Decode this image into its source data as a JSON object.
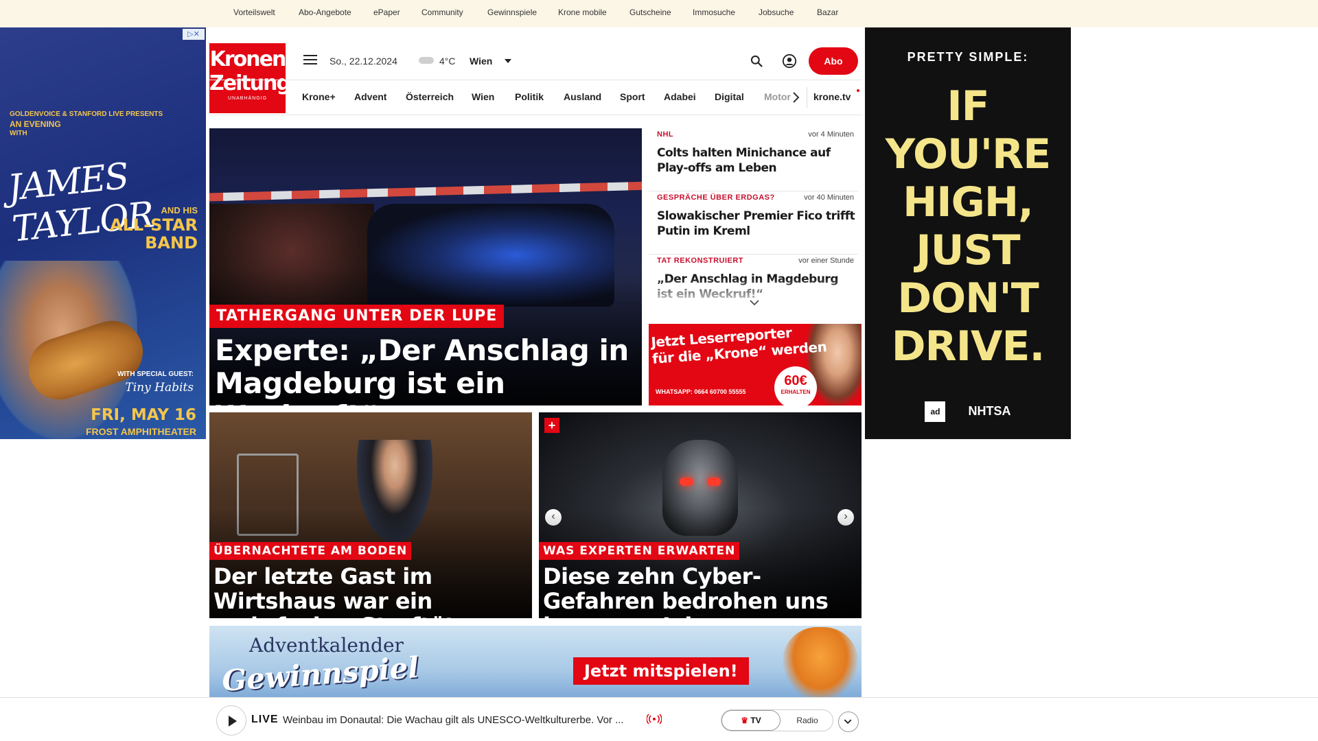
{
  "topbar": {
    "links": [
      "Vorteilswelt",
      "Abo-Angebote",
      "ePaper",
      "Community",
      "Gewinnspiele",
      "Krone mobile",
      "Gutscheine",
      "Immosuche",
      "Jobsuche",
      "Bazar"
    ]
  },
  "ad_left": {
    "close_label": "▷✕",
    "presents_line1": "GOLDENVOICE & STANFORD LIVE PRESENTS",
    "presents_line2": "AN EVENING",
    "presents_line3": "WITH",
    "headliner": "JAMES TAYLOR",
    "band_line1": "AND HIS",
    "band_line2": "ALL-STAR",
    "band_line3": "BAND",
    "guest_label": "WITH SPECIAL GUEST:",
    "guest_name": "Tiny Habits",
    "date": "FRI, MAY 16",
    "venue": "FROST AMPHITHEATER"
  },
  "ad_right": {
    "headline": "PRETTY SIMPLE:",
    "message": "IF YOU'RE HIGH, JUST DON'T DRIVE.",
    "logo1": "ad",
    "logo2": "NHTSA"
  },
  "header": {
    "logo_line1": "Kronen",
    "logo_line2": "Zeitung",
    "logo_tagline": "UNABHÄNGIG",
    "date": "So., 22.12.2024",
    "temperature": "4°C",
    "city": "Wien",
    "abo_label": "Abo"
  },
  "nav": {
    "items": [
      "Krone+",
      "Advent",
      "Österreich",
      "Wien",
      "Politik",
      "Ausland",
      "Sport",
      "Adabei",
      "Digital",
      "Motor"
    ],
    "tv": "krone.tv"
  },
  "hero": {
    "kicker": "TATHERGANG UNTER DER LUPE",
    "title": "Experte: „Der Anschlag in Magdeburg ist ein Weckruf!“"
  },
  "sidelist": [
    {
      "category": "NHL",
      "time": "vor 4 Minuten",
      "title": "Colts halten Minichance auf Play-offs am Leben"
    },
    {
      "category": "GESPRÄCHE ÜBER ERDGAS?",
      "time": "vor 40 Minuten",
      "title": "Slowakischer Premier Fico trifft Putin im Kreml"
    },
    {
      "category": "TAT REKONSTRUIERT",
      "time": "vor einer Stunde",
      "title": "„Der Anschlag in Magdeburg ist ein Weckruf!“"
    }
  ],
  "ad_leserreporter": {
    "line1": "Jetzt Leserreporter",
    "line2": "für die „Krone“ werden",
    "whatsapp": "WHATSAPP: 0664 60700 55555",
    "amount": "60€",
    "amount_sub": "ERHALTEN"
  },
  "tiles": [
    {
      "kicker": "ÜBERNACHTETE AM BODEN",
      "title": "Der letzte Gast im Wirtshaus war ein mehrfacher Straftäter"
    },
    {
      "kicker": "WAS EXPERTEN ERWARTEN",
      "title": "Diese zehn Cyber-Gefahren bedrohen uns im neuen Jahr",
      "badge": "+"
    }
  ],
  "advent": {
    "line1": "Adventkalender",
    "line2": "Gewinnspiel",
    "cta": "Jetzt mitspielen!"
  },
  "player": {
    "live_label": "LIVE",
    "ticker": "Weinbau im Donautal: Die Wachau gilt als UNESCO-Weltkulturerbe. Vor ...",
    "tv_label": "TV",
    "radio_label": "Radio"
  },
  "colors": {
    "brand_red": "#e30613",
    "topbar_bg": "#fbf6e6",
    "ad_right_text": "#f4e58a"
  }
}
